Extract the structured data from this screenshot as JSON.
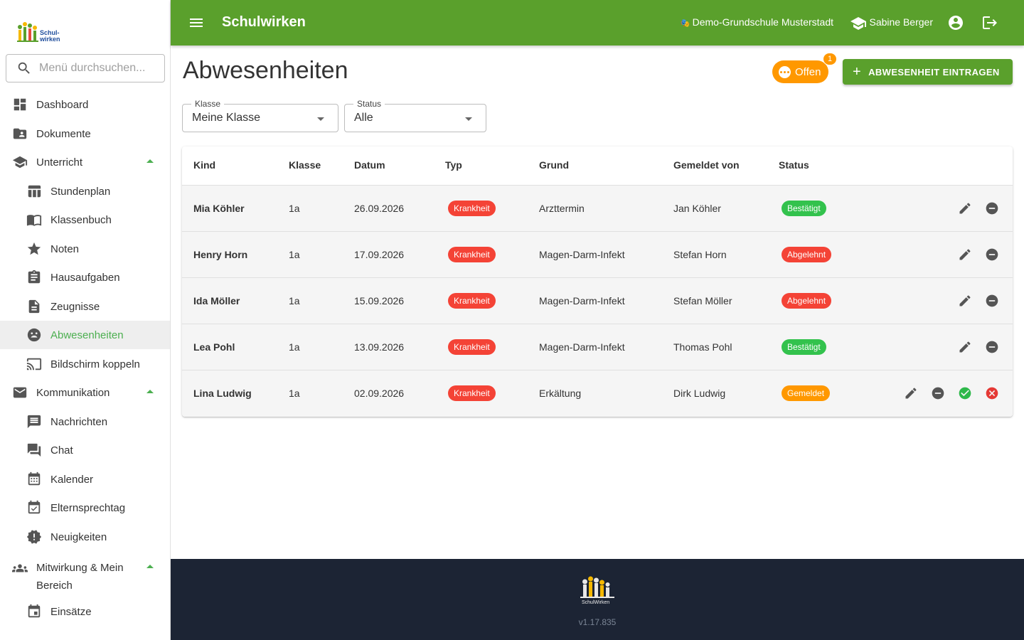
{
  "sidebar": {
    "search_placeholder": "Menü durchsuchen...",
    "items": [
      {
        "label": "Dashboard"
      },
      {
        "label": "Dokumente"
      },
      {
        "label": "Unterricht"
      },
      {
        "label": "Stundenplan"
      },
      {
        "label": "Klassenbuch"
      },
      {
        "label": "Noten"
      },
      {
        "label": "Hausaufgaben"
      },
      {
        "label": "Zeugnisse"
      },
      {
        "label": "Abwesenheiten"
      },
      {
        "label": "Bildschirm koppeln"
      },
      {
        "label": "Kommunikation"
      },
      {
        "label": "Nachrichten"
      },
      {
        "label": "Chat"
      },
      {
        "label": "Kalender"
      },
      {
        "label": "Elternsprechtag"
      },
      {
        "label": "Neuigkeiten"
      },
      {
        "label": "Mitwirkung & Mein Bereich"
      },
      {
        "label": "Einsätze"
      }
    ]
  },
  "topbar": {
    "title": "Schulwirken",
    "school": "Demo-Grundschule Musterstadt",
    "user": "Sabine Berger"
  },
  "main": {
    "title": "Abwesenheiten",
    "offen_label": "Offen",
    "offen_count": "1",
    "add_button": "ABWESENHEIT EINTRAGEN",
    "filters": {
      "klasse_label": "Klasse",
      "klasse_value": "Meine Klasse",
      "status_label": "Status",
      "status_value": "Alle"
    }
  },
  "table": {
    "headers": [
      "Kind",
      "Klasse",
      "Datum",
      "Typ",
      "Grund",
      "Gemeldet von",
      "Status"
    ],
    "rows": [
      {
        "kind": "Mia Köhler",
        "klasse": "1a",
        "datum": "26.09.2026",
        "typ": "Krankheit",
        "grund": "Arzttermin",
        "gemeldet": "Jan Köhler",
        "status": "Bestätigt"
      },
      {
        "kind": "Henry Horn",
        "klasse": "1a",
        "datum": "17.09.2026",
        "typ": "Krankheit",
        "grund": "Magen-Darm-Infekt",
        "gemeldet": "Stefan Horn",
        "status": "Abgelehnt"
      },
      {
        "kind": "Ida Möller",
        "klasse": "1a",
        "datum": "15.09.2026",
        "typ": "Krankheit",
        "grund": "Magen-Darm-Infekt",
        "gemeldet": "Stefan Möller",
        "status": "Abgelehnt"
      },
      {
        "kind": "Lea Pohl",
        "klasse": "1a",
        "datum": "13.09.2026",
        "typ": "Krankheit",
        "grund": "Magen-Darm-Infekt",
        "gemeldet": "Thomas Pohl",
        "status": "Bestätigt"
      },
      {
        "kind": "Lina Ludwig",
        "klasse": "1a",
        "datum": "02.09.2026",
        "typ": "Krankheit",
        "grund": "Erkältung",
        "gemeldet": "Dirk Ludwig",
        "status": "Gemeldet"
      }
    ]
  },
  "colors": {
    "brand_green": "#5aa02c",
    "active_text": "#4caf50",
    "red": "#f44336",
    "green": "#33c24d",
    "orange": "#ff9800",
    "footer": "#1c2434"
  },
  "footer": {
    "version": "v1.17.835"
  }
}
